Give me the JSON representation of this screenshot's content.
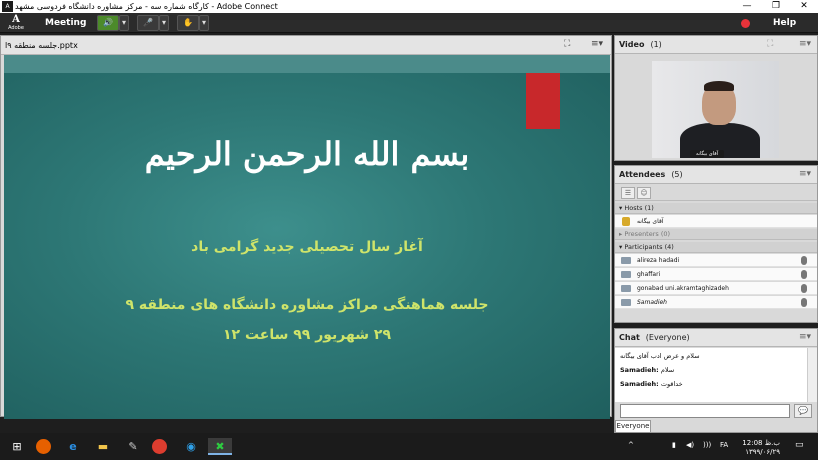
{
  "window": {
    "title": "کارگاه شماره سه - مرکز مشاوره دانشگاه فردوسی مشهد - Adobe Connect",
    "controls": [
      "—",
      "❐",
      "✕"
    ]
  },
  "menubar": {
    "logo_mark": "A",
    "logo_text": "Adobe",
    "meeting_label": "Meeting",
    "speaker_icon": "🔊",
    "mic_icon": "🎤",
    "raise_hand_icon": "✋",
    "help_label": "Help",
    "record_color": "#e8333a"
  },
  "share_pod": {
    "filename": "جلسه منطقه ۹ا.pptx",
    "slide": {
      "line1": "بسم الله الرحمن الرحیم",
      "line2": "آغاز سال تحصیلی جدید گرامی باد",
      "line3": "جلسه هماهنگی مراکز مشاوره دانشگاه های منطقه ۹",
      "line4": "۲۹ شهریور ۹۹ ساعت ۱۲"
    }
  },
  "video_pod": {
    "title": "Video",
    "count": "(1)",
    "name_tag": "آقای بیگانه"
  },
  "attendees_pod": {
    "title": "Attendees",
    "count": "(5)",
    "sections": {
      "hosts": "Hosts (1)",
      "presenters": "Presenters (0)",
      "participants": "Participants (4)"
    },
    "hosts": [
      "آقای بیگانه"
    ],
    "participants": [
      "alireza hadadi",
      "ghaffari",
      "gonabad uni.akramtaghizadeh",
      "Samadieh"
    ]
  },
  "chat_pod": {
    "title": "Chat",
    "scope": "(Everyone)",
    "messages": [
      {
        "sender": "",
        "text": "سلام و عرض ادب آقای بیگانه"
      },
      {
        "sender": "Samadieh:",
        "text": "سلام"
      },
      {
        "sender": "Samadieh:",
        "text": "خداقوت"
      }
    ],
    "send_icon": "💬",
    "recipient": "Everyone"
  },
  "taskbar": {
    "start_icon": "⊞",
    "search_icon": "⌕",
    "apps": [
      "firefox-icon",
      "edge-icon",
      "explorer-icon",
      "chrome-icon",
      "connect-icon"
    ],
    "tray": {
      "lang": "FA",
      "time": "12:08 ب.ظ",
      "date": "۱۳۹۹/۰۶/۲۹"
    }
  }
}
